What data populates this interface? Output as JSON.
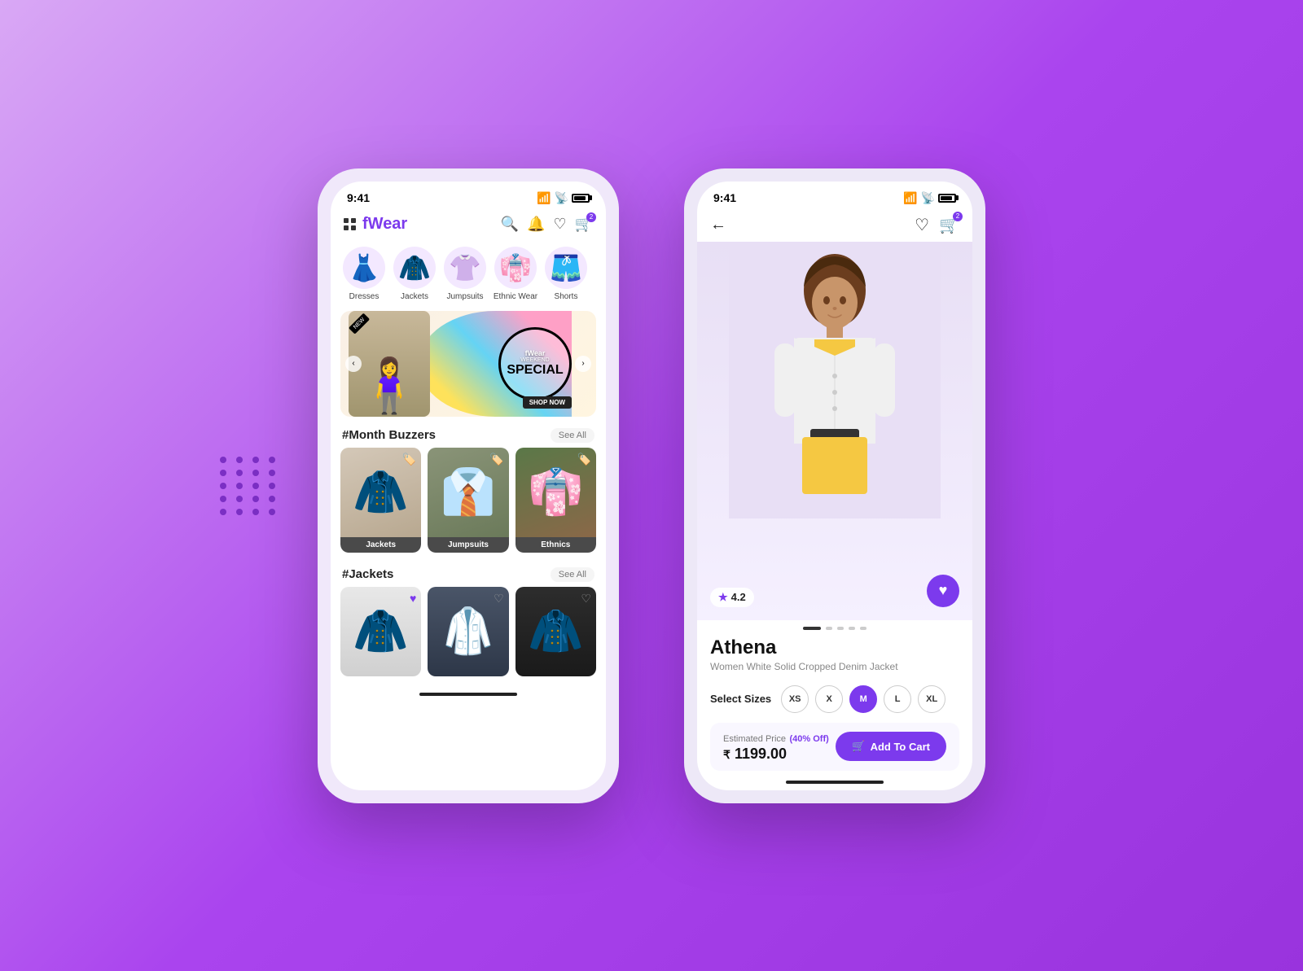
{
  "app": {
    "name_prefix": "f",
    "name_suffix": "Wear",
    "time": "9:41"
  },
  "phone1": {
    "header": {
      "search_icon": "🔍",
      "bell_icon": "🔔",
      "heart_icon": "♡",
      "cart_icon": "🛒"
    },
    "categories": [
      {
        "id": "dresses",
        "label": "Dresses",
        "emoji": "👗"
      },
      {
        "id": "jackets",
        "label": "Jackets",
        "emoji": "🧥"
      },
      {
        "id": "jumpsuits",
        "label": "Jumpsuits",
        "emoji": "👚"
      },
      {
        "id": "ethnic",
        "label": "Ethnic Wear",
        "emoji": "👘"
      },
      {
        "id": "shorts",
        "label": "Shorts",
        "emoji": "🩳"
      }
    ],
    "banner": {
      "brand": "fWear",
      "sub": "WEEKEND",
      "main": "SPECIAL",
      "shop_btn": "SHOP NOW",
      "new_tag": "NEW"
    },
    "month_buzzers": {
      "title": "#Month Buzzers",
      "see_all": "See All",
      "products": [
        {
          "id": "p1",
          "label": "Jackets"
        },
        {
          "id": "p2",
          "label": "Jumpsuits"
        },
        {
          "id": "p3",
          "label": "Ethnics"
        }
      ]
    },
    "jackets": {
      "title": "#Jackets",
      "see_all": "See All",
      "products": [
        {
          "id": "j1",
          "color": "white"
        },
        {
          "id": "j2",
          "color": "blue"
        },
        {
          "id": "j3",
          "color": "black"
        }
      ]
    }
  },
  "phone2": {
    "time": "9:41",
    "product": {
      "name": "Athena",
      "description": "Women White Solid Cropped Denim Jacket",
      "rating": "4.2",
      "sizes": [
        "XS",
        "X",
        "M",
        "L",
        "XL"
      ],
      "selected_size": "M",
      "estimated_label": "Estimated Price",
      "discount": "(40% Off)",
      "currency": "₹",
      "price": "1199.00",
      "add_to_cart": "Add To Cart"
    },
    "pagination_dots": 5,
    "active_dot": 0
  }
}
